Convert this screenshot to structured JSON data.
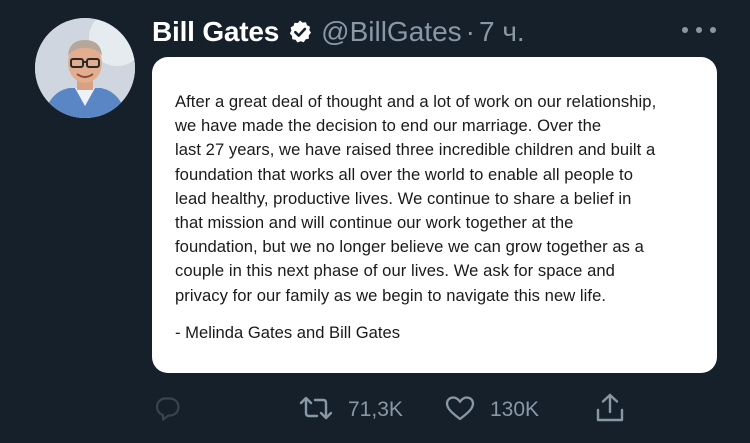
{
  "tweet": {
    "display_name": "Bill Gates",
    "handle": "@BillGates",
    "separator": "·",
    "time": "7 ч.",
    "verified": true,
    "media": {
      "statement": "After a great deal of thought and a lot of work on our relationship,\nwe have made the decision to end our marriage. Over the\nlast 27 years, we have raised three incredible children and built a\nfoundation that works all over the world to enable all people to\nlead healthy, productive lives. We continue to share a belief in\nthat mission and will continue our work together at the\nfoundation, but we no longer believe we can grow together as a\ncouple in this next phase of our lives. We ask for space and\nprivacy for our family as we begin to navigate this new life.",
      "signature": "- Melinda Gates and Bill Gates"
    },
    "actions": {
      "reply_icon": "reply-icon",
      "retweet_icon": "retweet-icon",
      "retweet_count": "71,3K",
      "like_icon": "heart-icon",
      "like_count": "130K",
      "share_icon": "share-icon"
    }
  },
  "colors": {
    "background": "#15202b",
    "secondary_text": "#8899a6",
    "verified_badge": "#ffffff",
    "card_background": "#ffffff",
    "card_text": "#1a1a1a"
  }
}
